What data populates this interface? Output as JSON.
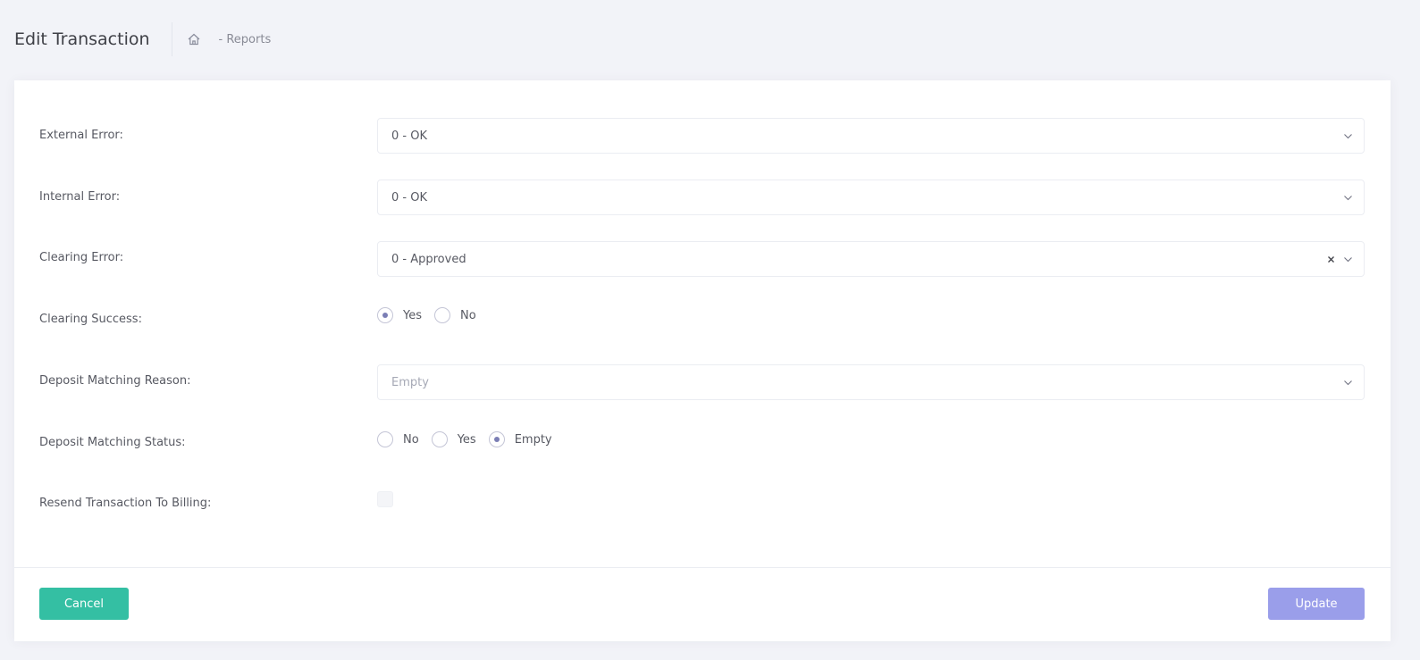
{
  "header": {
    "title": "Edit Transaction",
    "breadcrumb_home_icon": "home-icon",
    "breadcrumb_text": "- Reports"
  },
  "form": {
    "external_error": {
      "label": "External Error:",
      "value": "0 - OK"
    },
    "internal_error": {
      "label": "Internal Error:",
      "value": "0 - OK"
    },
    "clearing_error": {
      "label": "Clearing Error:",
      "value": "0 - Approved"
    },
    "clearing_success": {
      "label": "Clearing Success:",
      "options": [
        "Yes",
        "No"
      ],
      "selected": "Yes"
    },
    "deposit_matching_reason": {
      "label": "Deposit Matching Reason:",
      "placeholder": "Empty"
    },
    "deposit_matching_status": {
      "label": "Deposit Matching Status:",
      "options": [
        "No",
        "Yes",
        "Empty"
      ],
      "selected": "Empty"
    },
    "resend_to_billing": {
      "label": "Resend Transaction To Billing:",
      "checked": false
    }
  },
  "footer": {
    "cancel_label": "Cancel",
    "update_label": "Update"
  },
  "colors": {
    "cancel": "#34bfa3",
    "update": "#9a9eea",
    "radio_selected": "#7b7eb5",
    "background": "#f2f3f8"
  }
}
